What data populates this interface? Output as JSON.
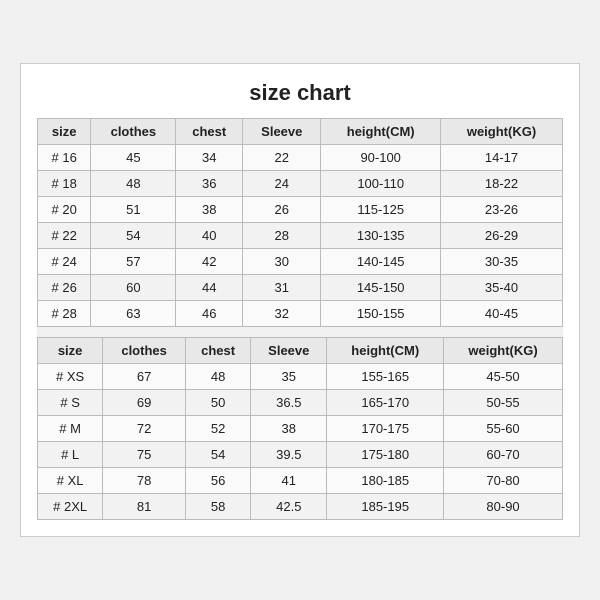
{
  "title": "size chart",
  "tables": [
    {
      "id": "kids",
      "headers": [
        "size",
        "clothes",
        "chest",
        "Sleeve",
        "height(CM)",
        "weight(KG)"
      ],
      "rows": [
        [
          "# 16",
          "45",
          "34",
          "22",
          "90-100",
          "14-17"
        ],
        [
          "# 18",
          "48",
          "36",
          "24",
          "100-110",
          "18-22"
        ],
        [
          "# 20",
          "51",
          "38",
          "26",
          "115-125",
          "23-26"
        ],
        [
          "# 22",
          "54",
          "40",
          "28",
          "130-135",
          "26-29"
        ],
        [
          "# 24",
          "57",
          "42",
          "30",
          "140-145",
          "30-35"
        ],
        [
          "# 26",
          "60",
          "44",
          "31",
          "145-150",
          "35-40"
        ],
        [
          "# 28",
          "63",
          "46",
          "32",
          "150-155",
          "40-45"
        ]
      ]
    },
    {
      "id": "adults",
      "headers": [
        "size",
        "clothes",
        "chest",
        "Sleeve",
        "height(CM)",
        "weight(KG)"
      ],
      "rows": [
        [
          "# XS",
          "67",
          "48",
          "35",
          "155-165",
          "45-50"
        ],
        [
          "# S",
          "69",
          "50",
          "36.5",
          "165-170",
          "50-55"
        ],
        [
          "# M",
          "72",
          "52",
          "38",
          "170-175",
          "55-60"
        ],
        [
          "# L",
          "75",
          "54",
          "39.5",
          "175-180",
          "60-70"
        ],
        [
          "# XL",
          "78",
          "56",
          "41",
          "180-185",
          "70-80"
        ],
        [
          "# 2XL",
          "81",
          "58",
          "42.5",
          "185-195",
          "80-90"
        ]
      ]
    }
  ]
}
